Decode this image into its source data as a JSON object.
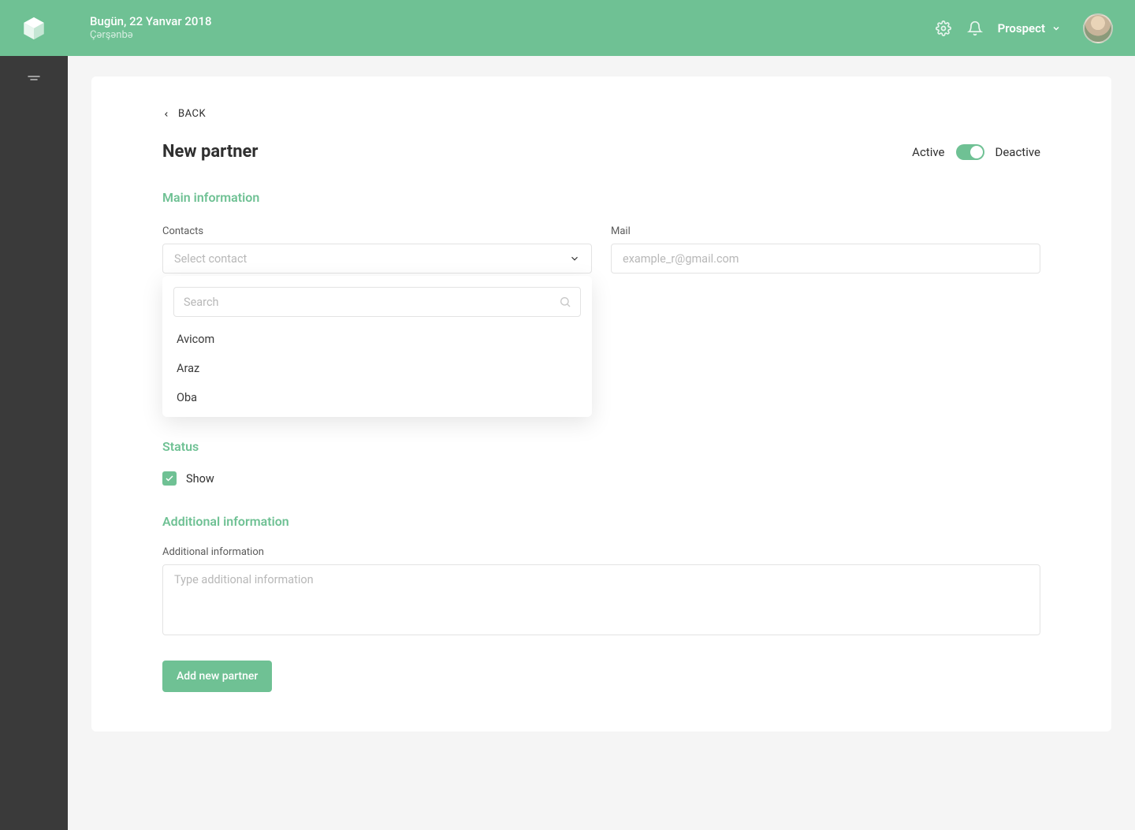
{
  "header": {
    "date_line": "Bugün, 22 Yanvar 2018",
    "day_line": "Çərşənbə",
    "user_menu_label": "Prospect"
  },
  "nav": {
    "back_label": "BACK"
  },
  "page": {
    "title": "New partner",
    "active_label": "Active",
    "deactive_label": "Deactive"
  },
  "sections": {
    "main_info_heading": "Main information",
    "status_heading": "Status",
    "additional_heading": "Additional information"
  },
  "fields": {
    "contacts_label": "Contacts",
    "contacts_placeholder": "Select contact",
    "mail_label": "Mail",
    "mail_placeholder": "example_r@gmail.com",
    "additional_label": "Additional information",
    "additional_placeholder": "Type additional information"
  },
  "dropdown": {
    "search_placeholder": "Search",
    "options": [
      "Avicom",
      "Araz",
      "Oba"
    ]
  },
  "status": {
    "show_label": "Show"
  },
  "buttons": {
    "submit_label": "Add new partner"
  },
  "colors": {
    "accent": "#6fc194",
    "sidebar": "#3a3a3a",
    "border": "#e3e3e3"
  }
}
